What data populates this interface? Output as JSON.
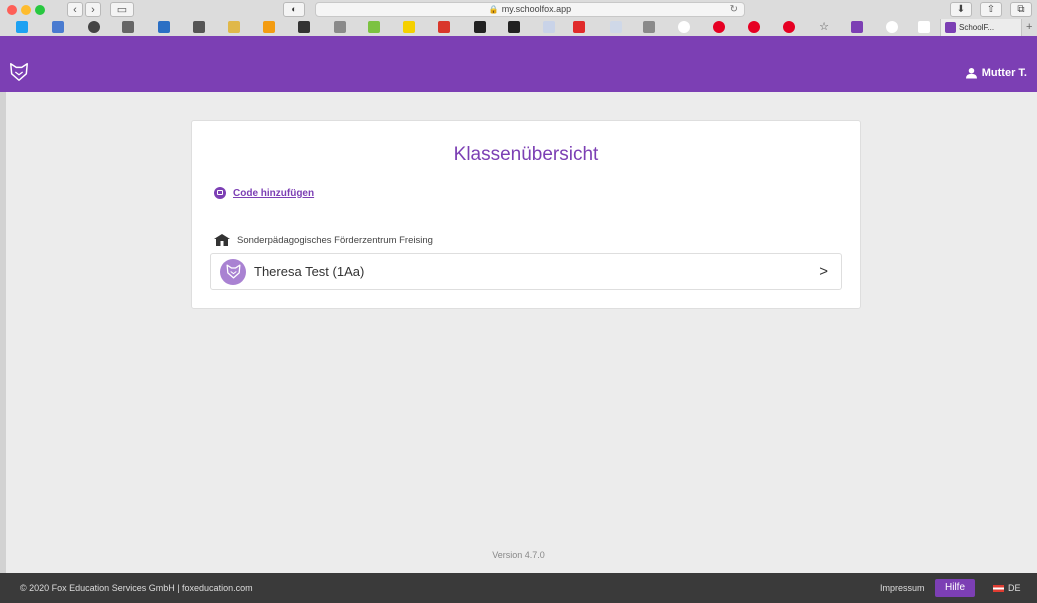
{
  "browser": {
    "url": "my.schoolfox.app",
    "tab_title": "SchoolF...",
    "colors": {
      "accent": "#7c3fb4"
    }
  },
  "header": {
    "logo_icon": "fox-logo-icon",
    "user_name": "Mutter T."
  },
  "main": {
    "title": "Klassenübersicht",
    "add_code_label": "Code hinzufügen",
    "school_name": "Sonderpädagogisches Förderzentrum Freising",
    "classes": [
      {
        "name": "Theresa Test (1Aa)"
      }
    ]
  },
  "version": "Version 4.7.0",
  "footer": {
    "copyright": "© 2020 Fox Education Services GmbH | foxeducation.com",
    "impressum": "Impressum",
    "help": "Hilfe",
    "language": "DE"
  }
}
